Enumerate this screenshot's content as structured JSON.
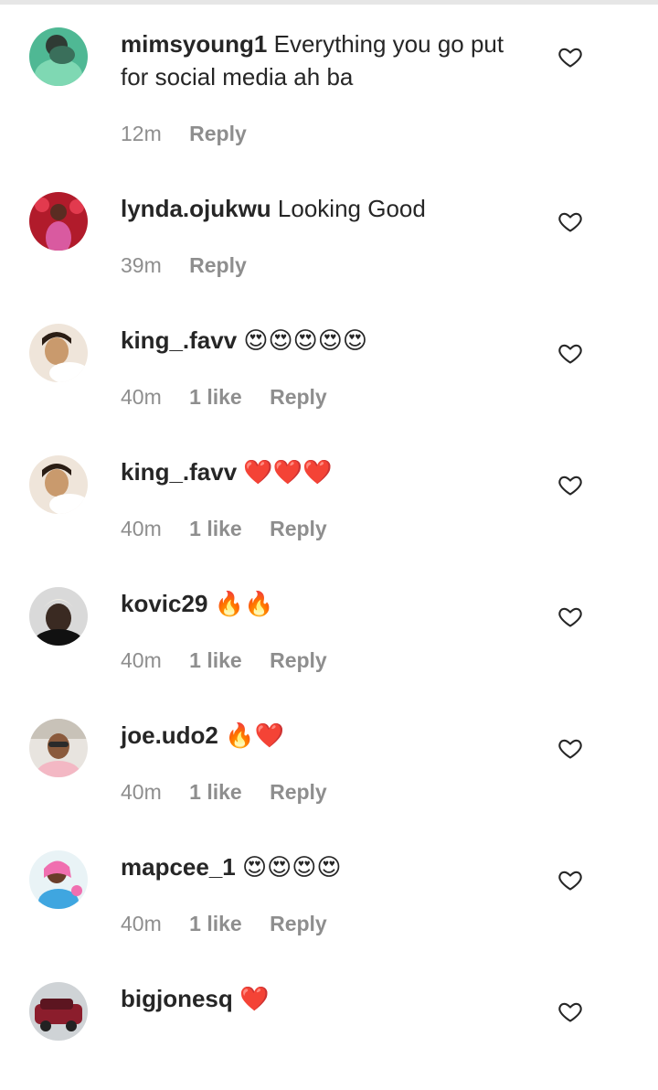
{
  "comments": [
    {
      "username": "mimsyoung1",
      "text": "Everything you go put for social media ah ba",
      "time": "12m",
      "likes": "",
      "reply": "Reply",
      "avatar": "avatar-green"
    },
    {
      "username": "lynda.ojukwu",
      "text": "Looking Good",
      "time": "39m",
      "likes": "",
      "reply": "Reply",
      "avatar": "avatar-red"
    },
    {
      "username": "king_.favv",
      "text": "😍😍😍😍😍",
      "time": "40m",
      "likes": "1 like",
      "reply": "Reply",
      "avatar": "avatar-girl"
    },
    {
      "username": "king_.favv",
      "text": "❤️❤️❤️",
      "time": "40m",
      "likes": "1 like",
      "reply": "Reply",
      "avatar": "avatar-girl"
    },
    {
      "username": "kovic29",
      "text": "🔥🔥",
      "time": "40m",
      "likes": "1 like",
      "reply": "Reply",
      "avatar": "avatar-blond"
    },
    {
      "username": "joe.udo2",
      "text": "🔥❤️",
      "time": "40m",
      "likes": "1 like",
      "reply": "Reply",
      "avatar": "avatar-glasses"
    },
    {
      "username": "mapcee_1",
      "text": "😍😍😍😍",
      "time": "40m",
      "likes": "1 like",
      "reply": "Reply",
      "avatar": "avatar-pink"
    },
    {
      "username": "bigjonesq",
      "text": "❤️",
      "time": "",
      "likes": "",
      "reply": "",
      "avatar": "avatar-car"
    }
  ]
}
